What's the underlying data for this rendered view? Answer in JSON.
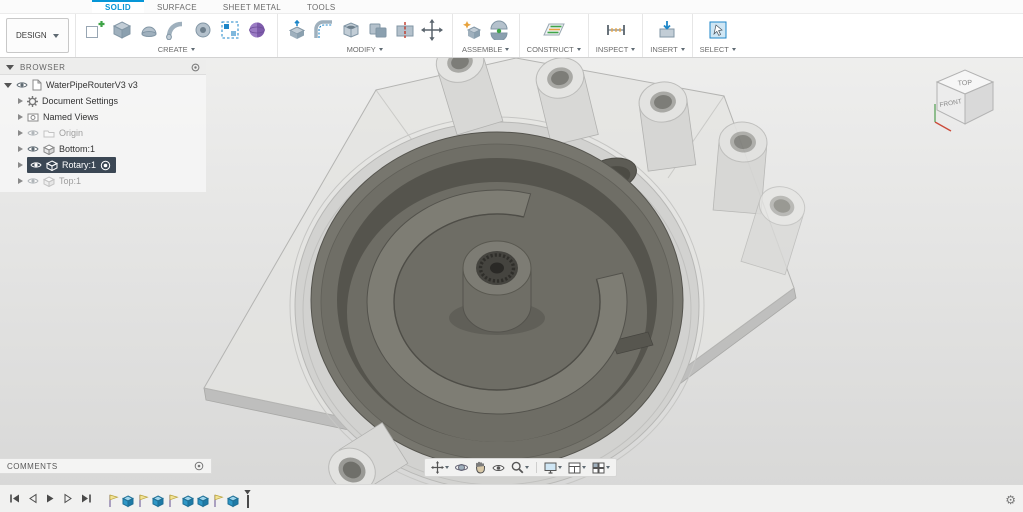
{
  "toolbar": {
    "design_menu_label": "DESIGN",
    "tabs": [
      {
        "label": "SOLID",
        "active": true
      },
      {
        "label": "SURFACE",
        "active": false
      },
      {
        "label": "SHEET METAL",
        "active": false
      },
      {
        "label": "TOOLS",
        "active": false
      }
    ],
    "groups": [
      {
        "label": "CREATE"
      },
      {
        "label": "MODIFY"
      },
      {
        "label": "ASSEMBLE"
      },
      {
        "label": "CONSTRUCT"
      },
      {
        "label": "INSPECT"
      },
      {
        "label": "INSERT"
      },
      {
        "label": "SELECT"
      }
    ]
  },
  "browser": {
    "title": "BROWSER",
    "items": [
      {
        "label": "WaterPipeRouterV3 v3",
        "selected": false
      },
      {
        "label": "Document Settings",
        "selected": false
      },
      {
        "label": "Named Views",
        "selected": false
      },
      {
        "label": "Origin",
        "selected": false
      },
      {
        "label": "Bottom:1",
        "selected": false
      },
      {
        "label": "Rotary:1",
        "selected": true
      },
      {
        "label": "Top:1",
        "selected": false
      }
    ]
  },
  "viewcube": {
    "top_label": "TOP",
    "front_label": "FRONT"
  },
  "comments": {
    "title": "COMMENTS"
  },
  "timeline": {
    "items": [
      "sketch",
      "component",
      "sketch",
      "component",
      "sketch",
      "component",
      "component",
      "sketch",
      "component"
    ]
  },
  "colors": {
    "accent_blue": "#0696d7",
    "selection_dark": "#3b4754",
    "model_dark_gray": "#6e6d65",
    "model_light_gray": "#d9d9d7"
  },
  "icons": {
    "gear": "⚙"
  }
}
